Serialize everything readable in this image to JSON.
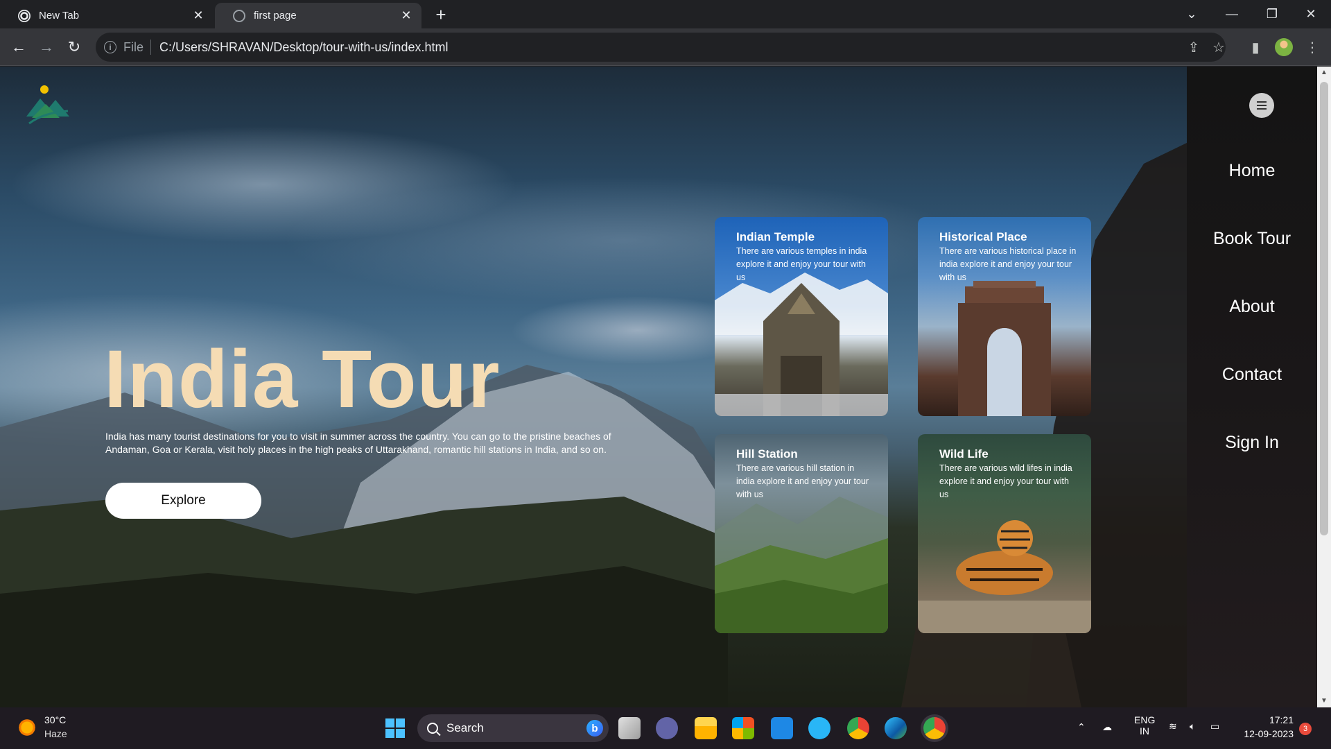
{
  "browser": {
    "tabs": [
      {
        "title": "New Tab",
        "active": false
      },
      {
        "title": "first page",
        "active": true
      }
    ],
    "address": {
      "scheme": "File",
      "url": "C:/Users/SHRAVAN/Desktop/tour-with-us/index.html"
    }
  },
  "hero": {
    "title": "India Tour",
    "description": "India has many tourist destinations for you to visit in summer across the country. You can go to the pristine beaches of Andaman, Goa or Kerala, visit holy places in the high peaks of Uttarakhand, romantic hill stations in India, and so on.",
    "explore_label": "Explore"
  },
  "cards": [
    {
      "title": "Indian Temple",
      "text": "There are various temples in india explore it and enjoy your tour with us"
    },
    {
      "title": "Historical Place",
      "text": "There are various historical place in india explore it and enjoy your tour with us"
    },
    {
      "title": "Hill Station",
      "text": "There are various hill station in india explore it and enjoy your tour with us"
    },
    {
      "title": "Wild Life",
      "text": "There are various wild lifes in india explore it and enjoy your tour with us"
    }
  ],
  "nav": {
    "items": [
      "Home",
      "Book Tour",
      "About",
      "Contact",
      "Sign In"
    ]
  },
  "taskbar": {
    "weather_temp": "30°C",
    "weather_desc": "Haze",
    "search_label": "Search",
    "language_line1": "ENG",
    "language_line2": "IN",
    "time": "17:21",
    "date": "12-09-2023",
    "notification_count": "3"
  },
  "colors": {
    "hero_title": "#f5dcb4",
    "sidenav_bg": "#141414",
    "chrome_dark": "#202124",
    "chrome_toolbar": "#35363a"
  }
}
